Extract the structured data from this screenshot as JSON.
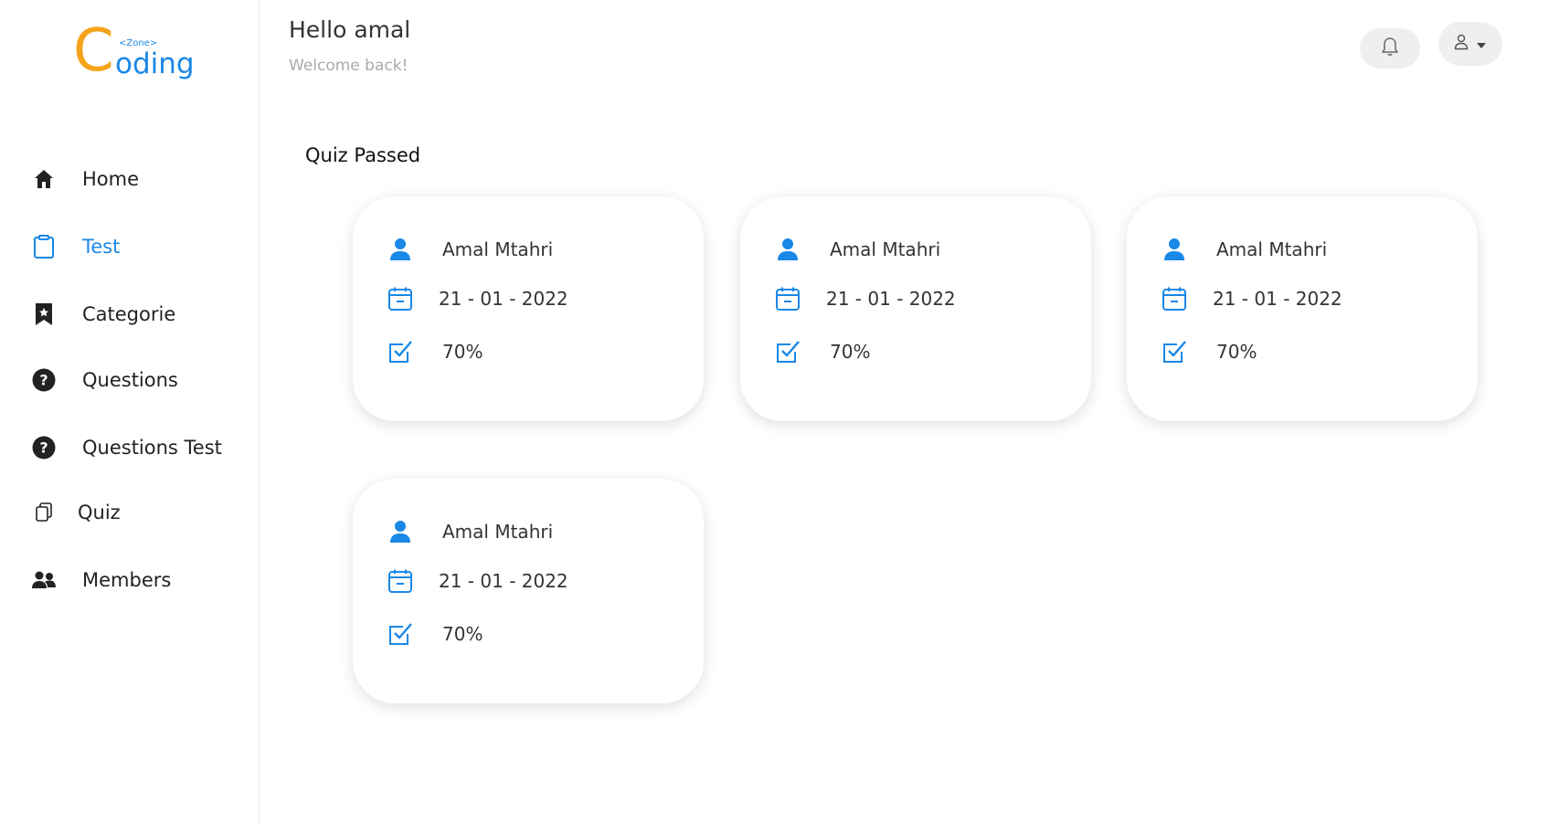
{
  "brand": {
    "logo_c": "C",
    "logo_zone": "<Zone>",
    "logo_oding": "oding"
  },
  "header": {
    "greeting": "Hello amal",
    "subtitle": "Welcome back!"
  },
  "sidebar": {
    "items": [
      {
        "label": "Home",
        "icon": "home-icon",
        "active": false
      },
      {
        "label": "Test",
        "icon": "clipboard-icon",
        "active": true
      },
      {
        "label": "Categorie",
        "icon": "bookmark-icon",
        "active": false
      },
      {
        "label": "Questions",
        "icon": "question-circle-icon",
        "active": false
      },
      {
        "label": "Questions Test",
        "icon": "question-circle-icon",
        "active": false
      },
      {
        "label": "Quiz",
        "icon": "copy-icon",
        "active": false
      },
      {
        "label": "Members",
        "icon": "users-icon",
        "active": false
      }
    ]
  },
  "main": {
    "section_title": "Quiz Passed",
    "cards": [
      {
        "name": "Amal Mtahri",
        "date": "21 - 01 - 2022",
        "score": "70%"
      },
      {
        "name": "Amal Mtahri",
        "date": "21 - 01 - 2022",
        "score": "70%"
      },
      {
        "name": "Amal Mtahri",
        "date": "21 - 01 - 2022",
        "score": "70%"
      },
      {
        "name": "Amal Mtahri",
        "date": "21 - 01 - 2022",
        "score": "70%"
      }
    ]
  },
  "colors": {
    "accent": "#1a88e6",
    "logo_orange": "#f5a31a",
    "text": "#222222",
    "muted": "#aaaaaa"
  }
}
